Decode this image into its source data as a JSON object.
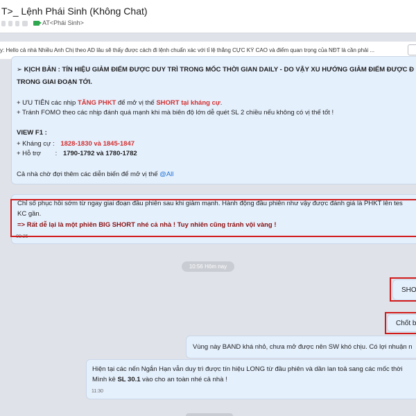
{
  "header": {
    "title": "T>_ Lệnh Phái Sinh (Không Chat)",
    "tag": "AT<Phái Sinh>"
  },
  "banner": {
    "text": "y: Hello cả nhà Nhiều Anh Chị theo AD lâu sẽ thấy được cách đi lệnh chuẩn xác với tỉ lệ thắng CỰC KỲ CAO và điểm quan trọng của NĐT là cần phải ..."
  },
  "messages": [
    {
      "lines": [
        "➢ KỊCH BẢN : TÍN HIỆU GIẢM ĐIỂM ĐƯỢC DUY TRÌ TRONG MỐC THỜI GIAN DAILY - DO VẬY XU HƯỚNG GIẢM ĐIỂM ĐƯỢC Đ",
        "TRONG GIAI ĐOẠN TỚI."
      ],
      "priority_prefix": "+ ƯU TIÊN các nhịp ",
      "priority_highlight": "TĂNG PHKT",
      "priority_mid": " để mở vị thế ",
      "priority_highlight2": "SHORT tại kháng cự",
      "priority_end": ".",
      "avoid": "+ Tránh FOMO theo các nhịp đánh quá mạnh khi mà biên độ lớn dễ quét SL 2 chiều nếu không có vị thế tốt !",
      "view_label": "VIEW F1 :",
      "resistance_label": "+ Kháng cự :",
      "resistance_value": "1828-1830 và 1845-1847",
      "support_label": "+ Hỗ trợ",
      "support_colon": ":",
      "support_value": "1790-1792 và 1780-1782",
      "closing": "Cả nhà chờ đợi thêm các diễn biến để mở vị thế ",
      "mention": "@All"
    },
    {
      "line1": "Chỉ số phục hồi sớm từ ngay giai đoạn đầu phiên sau khi giảm mạnh. Hành động đầu phiên như vậy được đánh giá là PHKT lên tes",
      "line2": "KC gần.",
      "line3": "=> Rất dễ lại là một phiên BIG SHORT nhé cả nhà ! Tuy nhiên cũng tránh vội vàng !",
      "time": "09:25"
    },
    {
      "text": "SHO"
    },
    {
      "text": "Chốt b"
    },
    {
      "text": "Vùng này BAND khá nhỏ, chưa mở được nên SW khó chịu. Có lợi nhuận n"
    },
    {
      "line1": "Hiện tại các nến Ngắn Hạn vẫn duy trì được tín hiệu LONG từ đầu phiên và dần lan toả sang các mốc thời",
      "line2_prefix": "Mình kê ",
      "line2_bold": "SL 30.1",
      "line2_suffix": " vào cho an toàn nhé cả nhà !",
      "time": "11:30"
    }
  ],
  "divider": "10:56 Hôm nay"
}
